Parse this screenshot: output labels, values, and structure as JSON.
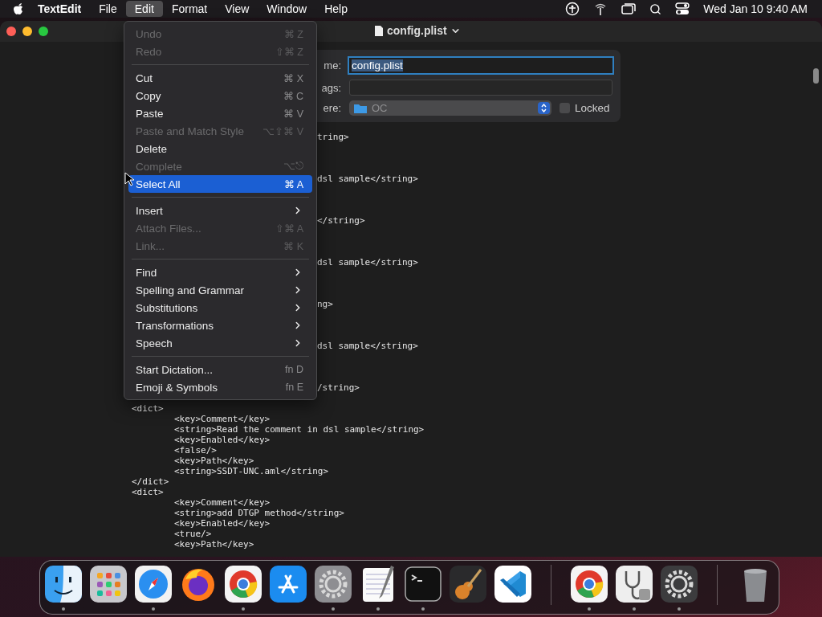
{
  "menu_bar": {
    "app_name": "TextEdit",
    "menus": [
      {
        "label": "File",
        "selected": false
      },
      {
        "label": "Edit",
        "selected": true
      },
      {
        "label": "Format",
        "selected": false
      },
      {
        "label": "View",
        "selected": false
      },
      {
        "label": "Window",
        "selected": false
      },
      {
        "label": "Help",
        "selected": false
      }
    ],
    "clock": "Wed Jan 10  9:40 AM"
  },
  "window": {
    "title": "config.plist"
  },
  "edit_menu": {
    "items": [
      {
        "kind": "item",
        "label": "Undo",
        "shortcut": "⌘ Z",
        "disabled": true,
        "selected": false
      },
      {
        "kind": "item",
        "label": "Redo",
        "shortcut": "⇧⌘ Z",
        "disabled": true,
        "selected": false
      },
      {
        "kind": "separator"
      },
      {
        "kind": "item",
        "label": "Cut",
        "shortcut": "⌘ X",
        "disabled": false,
        "selected": false
      },
      {
        "kind": "item",
        "label": "Copy",
        "shortcut": "⌘ C",
        "disabled": false,
        "selected": false
      },
      {
        "kind": "item",
        "label": "Paste",
        "shortcut": "⌘ V",
        "disabled": false,
        "selected": false
      },
      {
        "kind": "item",
        "label": "Paste and Match Style",
        "shortcut": "⌥⇧⌘ V",
        "disabled": true,
        "selected": false
      },
      {
        "kind": "item",
        "label": "Delete",
        "disabled": false,
        "selected": false
      },
      {
        "kind": "item",
        "label": "Complete",
        "shortcut": "⌥⎋",
        "disabled": true,
        "selected": false
      },
      {
        "kind": "item",
        "label": "Select All",
        "shortcut": "⌘ A",
        "disabled": false,
        "selected": true
      },
      {
        "kind": "separator"
      },
      {
        "kind": "submenu",
        "label": "Insert",
        "disabled": false,
        "selected": false
      },
      {
        "kind": "item",
        "label": "Attach Files...",
        "shortcut": "⇧⌘ A",
        "disabled": true,
        "selected": false
      },
      {
        "kind": "item",
        "label": "Link...",
        "shortcut": "⌘ K",
        "disabled": true,
        "selected": false
      },
      {
        "kind": "separator"
      },
      {
        "kind": "submenu",
        "label": "Find",
        "disabled": false,
        "selected": false
      },
      {
        "kind": "submenu",
        "label": "Spelling and Grammar",
        "disabled": false,
        "selected": false
      },
      {
        "kind": "submenu",
        "label": "Substitutions",
        "disabled": false,
        "selected": false
      },
      {
        "kind": "submenu",
        "label": "Transformations",
        "disabled": false,
        "selected": false
      },
      {
        "kind": "submenu",
        "label": "Speech",
        "disabled": false,
        "selected": false
      },
      {
        "kind": "separator"
      },
      {
        "kind": "item",
        "label": "Start Dictation...",
        "shortcut": "fn D",
        "disabled": false,
        "selected": false
      },
      {
        "kind": "item",
        "label": "Emoji & Symbols",
        "shortcut": "fn E",
        "disabled": false,
        "selected": false
      }
    ]
  },
  "save_popover": {
    "name_label": "me:",
    "name_value": "config.plist",
    "name_text_selected": true,
    "tags_label": "ags:",
    "where_label": "ere:",
    "where_value": "OC",
    "locked_label": "Locked",
    "locked": false
  },
  "document": {
    "fragments": [
      "tring>",
      "dsl sample</string>",
      "</string>",
      "dsl sample</string>",
      "ng>",
      "dsl sample</string>",
      "/string>"
    ],
    "lines": [
      "<dict>",
      "\t<key>Comment</key>",
      "\t<string>Read the comment in dsl sample</string>",
      "\t<key>Enabled</key>",
      "\t<false/>",
      "\t<key>Path</key>",
      "\t<string>SSDT-UNC.aml</string>",
      "</dict>",
      "<dict>",
      "\t<key>Comment</key>",
      "\t<string>add DTGP method</string>",
      "\t<key>Enabled</key>",
      "\t<true/>",
      "\t<key>Path</key>"
    ]
  },
  "dock": {
    "items": [
      {
        "kind": "app",
        "running": true
      },
      {
        "kind": "app",
        "running": false
      },
      {
        "kind": "app",
        "running": true
      },
      {
        "kind": "app",
        "running": false
      },
      {
        "kind": "app",
        "running": true
      },
      {
        "kind": "app",
        "running": false
      },
      {
        "kind": "app",
        "running": true
      },
      {
        "kind": "app",
        "running": true
      },
      {
        "kind": "app",
        "running": true
      },
      {
        "kind": "app",
        "running": false
      },
      {
        "kind": "app",
        "running": false
      },
      {
        "kind": "separator"
      },
      {
        "kind": "app",
        "running": true
      },
      {
        "kind": "app",
        "running": true
      },
      {
        "kind": "app",
        "running": true
      },
      {
        "kind": "separator"
      },
      {
        "kind": "app",
        "running": false
      }
    ]
  }
}
